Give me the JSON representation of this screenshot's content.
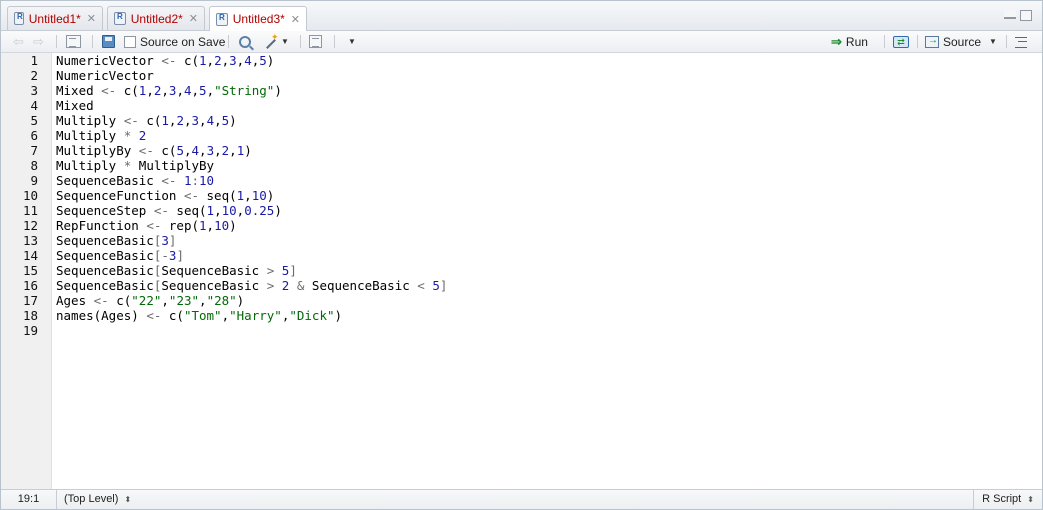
{
  "tabs": [
    {
      "label": "Untitled1*",
      "active": false
    },
    {
      "label": "Untitled2*",
      "active": false
    },
    {
      "label": "Untitled3*",
      "active": true
    }
  ],
  "toolbar": {
    "source_on_save_label": "Source on Save",
    "source_on_save_checked": false,
    "run_label": "Run",
    "source_label": "Source"
  },
  "editor": {
    "line_numbers": [
      "1",
      "2",
      "3",
      "4",
      "5",
      "6",
      "7",
      "8",
      "9",
      "10",
      "11",
      "12",
      "13",
      "14",
      "15",
      "16",
      "17",
      "18",
      "19"
    ],
    "lines": [
      "NumericVector <- c(1,2,3,4,5)",
      "NumericVector",
      "Mixed <- c(1,2,3,4,5,\"String\")",
      "Mixed",
      "Multiply <- c(1,2,3,4,5)",
      "Multiply * 2",
      "MultiplyBy <- c(5,4,3,2,1)",
      "Multiply * MultiplyBy",
      "SequenceBasic <- 1:10",
      "SequenceFunction <- seq(1,10)",
      "SequenceStep <- seq(1,10,0.25)",
      "RepFunction <- rep(1,10)",
      "SequenceBasic[3]",
      "SequenceBasic[-3]",
      "SequenceBasic[SequenceBasic > 5]",
      "SequenceBasic[SequenceBasic > 2 & SequenceBasic < 5]",
      "Ages <- c(\"22\",\"23\",\"28\")",
      "names(Ages) <- c(\"Tom\",\"Harry\",\"Dick\")",
      ""
    ]
  },
  "status": {
    "cursor_position": "19:1",
    "scope": "(Top Level)",
    "file_type": "R Script"
  },
  "colors": {
    "tab_label": "#b00000",
    "number": "#1a1aa6",
    "string": "#036a07",
    "operator": "#6b6b6b",
    "run_arrow": "#1c8a2d"
  }
}
